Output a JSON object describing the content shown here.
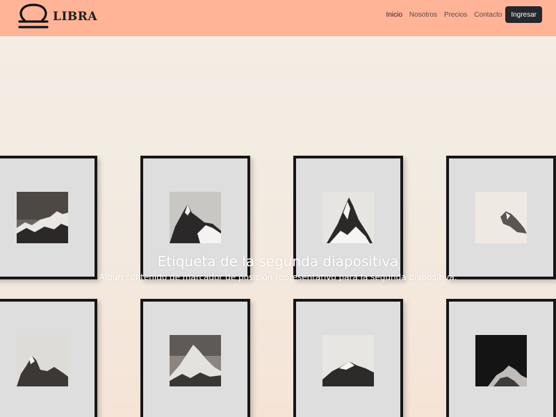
{
  "brand": {
    "name": "LIBRA",
    "logo_icon": "libra-symbol-icon"
  },
  "nav": {
    "links": [
      "Inicio",
      "Nosotros",
      "Precios",
      "Contacto"
    ],
    "active": "Inicio",
    "login_label": "Ingresar"
  },
  "carousel": {
    "caption_title": "Etiqueta de la segunda diapositiva",
    "caption_text": "Algún contenido de marcador de posición representativo para la segunda diapositiva."
  },
  "colors": {
    "navbar": "#ffb397",
    "button": "#24272c",
    "frame": "#161616"
  }
}
